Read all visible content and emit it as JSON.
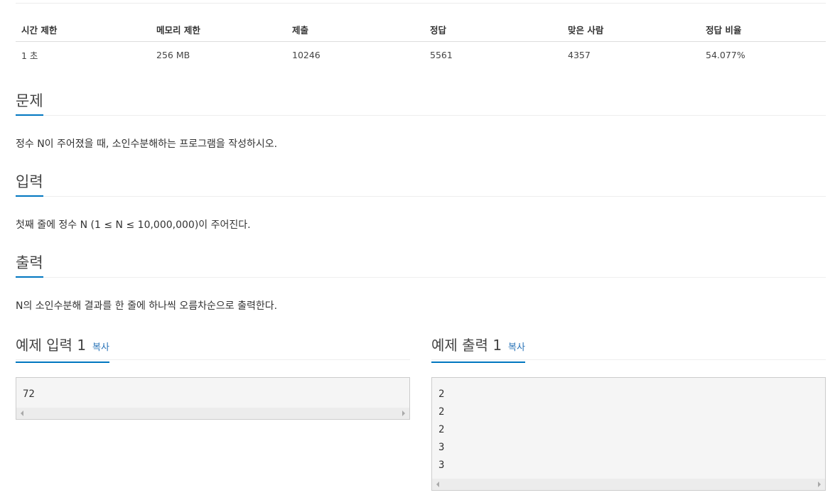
{
  "info_table": {
    "headers": [
      "시간 제한",
      "메모리 제한",
      "제출",
      "정답",
      "맞은 사람",
      "정답 비율"
    ],
    "values": [
      "1 초",
      "256 MB",
      "10246",
      "5561",
      "4357",
      "54.077%"
    ]
  },
  "problem": {
    "title": "문제",
    "description": "정수 N이 주어졌을 때, 소인수분해하는 프로그램을 작성하시오."
  },
  "input": {
    "title": "입력",
    "description": "첫째 줄에 정수 N (1 ≤ N ≤ 10,000,000)이 주어진다."
  },
  "output": {
    "title": "출력",
    "description": "N의 소인수분해 결과를 한 줄에 하나씩 오름차순으로 출력한다."
  },
  "sample_input": {
    "title": "예제 입력 1",
    "copy_label": "복사",
    "lines": [
      "72"
    ]
  },
  "sample_output": {
    "title": "예제 출력 1",
    "copy_label": "복사",
    "lines": [
      "2",
      "2",
      "2",
      "3",
      "3"
    ]
  },
  "colors": {
    "accent": "#0076c0",
    "link": "#2a74b8",
    "pre_bg": "#f5f5f5"
  }
}
